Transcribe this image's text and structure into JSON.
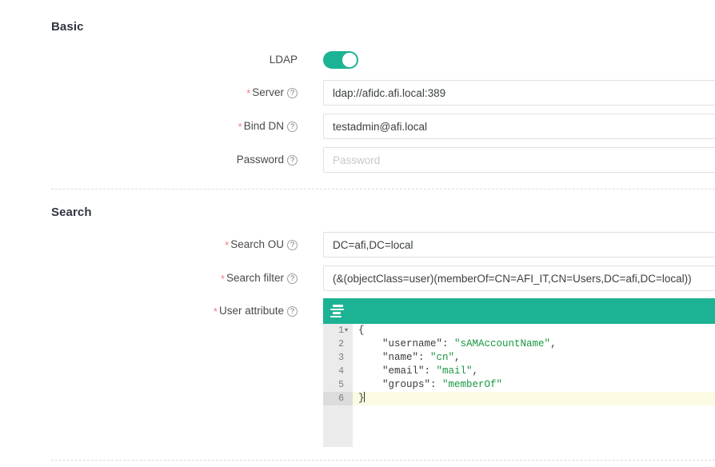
{
  "sections": [
    {
      "id": "basic",
      "title": "Basic"
    },
    {
      "id": "search",
      "title": "Search"
    }
  ],
  "basic": {
    "ldap": {
      "label": "LDAP",
      "toggle_state": "on",
      "accent_color": "#1cb394"
    },
    "server": {
      "label": "Server",
      "required": "*",
      "help": "?",
      "value": "ldap://afidc.afi.local:389",
      "placeholder": ""
    },
    "bind_dn": {
      "label": "Bind DN",
      "required": "*",
      "help": "?",
      "value": "testadmin@afi.local",
      "placeholder": ""
    },
    "password": {
      "label": "Password",
      "required": "",
      "help": "?",
      "value": "",
      "placeholder": "Password"
    }
  },
  "search": {
    "search_ou": {
      "label": "Search OU",
      "required": "*",
      "help": "?",
      "value": "DC=afi,DC=local",
      "placeholder": ""
    },
    "search_filter": {
      "label": "Search filter",
      "required": "*",
      "help": "?",
      "value": "(&(objectClass=user)(memberOf=CN=AFI_IT,CN=Users,DC=afi,DC=local))",
      "placeholder": ""
    },
    "user_attribute": {
      "label": "User attribute",
      "required": "*",
      "help": "?",
      "toolbar_icon": "format-align-icon",
      "toolbar_color": "#1cb394",
      "editor": {
        "active_line": 6,
        "lines": [
          {
            "num": "1",
            "fold": "▾",
            "tokens": [
              {
                "t": "{",
                "cls": "tok-key"
              }
            ]
          },
          {
            "num": "2",
            "fold": "",
            "tokens": [
              {
                "t": "    \"username\": ",
                "cls": "tok-key"
              },
              {
                "t": "\"sAMAccountName\"",
                "cls": "tok-str"
              },
              {
                "t": ",",
                "cls": "tok-key"
              }
            ]
          },
          {
            "num": "3",
            "fold": "",
            "tokens": [
              {
                "t": "    \"name\": ",
                "cls": "tok-key"
              },
              {
                "t": "\"cn\"",
                "cls": "tok-str"
              },
              {
                "t": ",",
                "cls": "tok-key"
              }
            ]
          },
          {
            "num": "4",
            "fold": "",
            "tokens": [
              {
                "t": "    \"email\": ",
                "cls": "tok-key"
              },
              {
                "t": "\"mail\"",
                "cls": "tok-str"
              },
              {
                "t": ",",
                "cls": "tok-key"
              }
            ]
          },
          {
            "num": "5",
            "fold": "",
            "tokens": [
              {
                "t": "    \"groups\": ",
                "cls": "tok-key"
              },
              {
                "t": "\"memberOf\"",
                "cls": "tok-str"
              }
            ]
          },
          {
            "num": "6",
            "fold": "",
            "tokens": [
              {
                "t": "}",
                "cls": "tok-key"
              }
            ]
          }
        ]
      }
    }
  }
}
